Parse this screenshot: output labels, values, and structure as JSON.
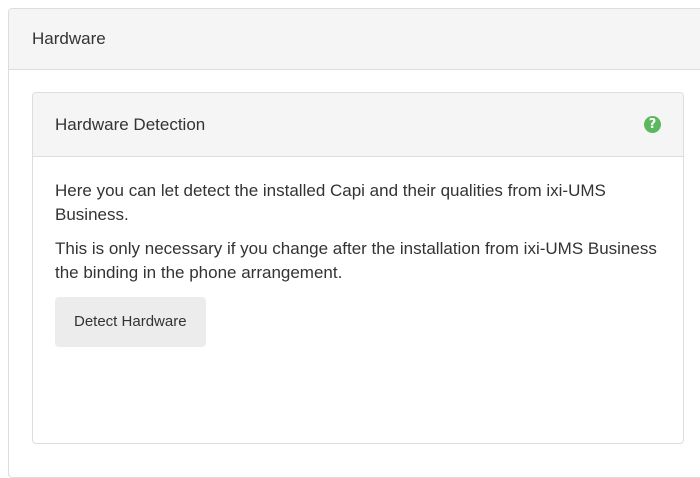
{
  "outer_panel": {
    "title": "Hardware"
  },
  "detection_panel": {
    "title": "Hardware Detection",
    "help_icon": "question-circle-icon",
    "help_glyph": "?",
    "paragraph_1": "Here you can let detect the installed Capi and their qualities from ixi-UMS Business.",
    "paragraph_2": "This is only necessary if you change after the installation from ixi-UMS Business the binding in the phone arrangement.",
    "button_label": "Detect Hardware"
  },
  "colors": {
    "heading_bg": "#f5f5f5",
    "border": "#dddddd",
    "help_icon": "#5cb85c",
    "button_bg": "#ececec",
    "text": "#333333"
  }
}
